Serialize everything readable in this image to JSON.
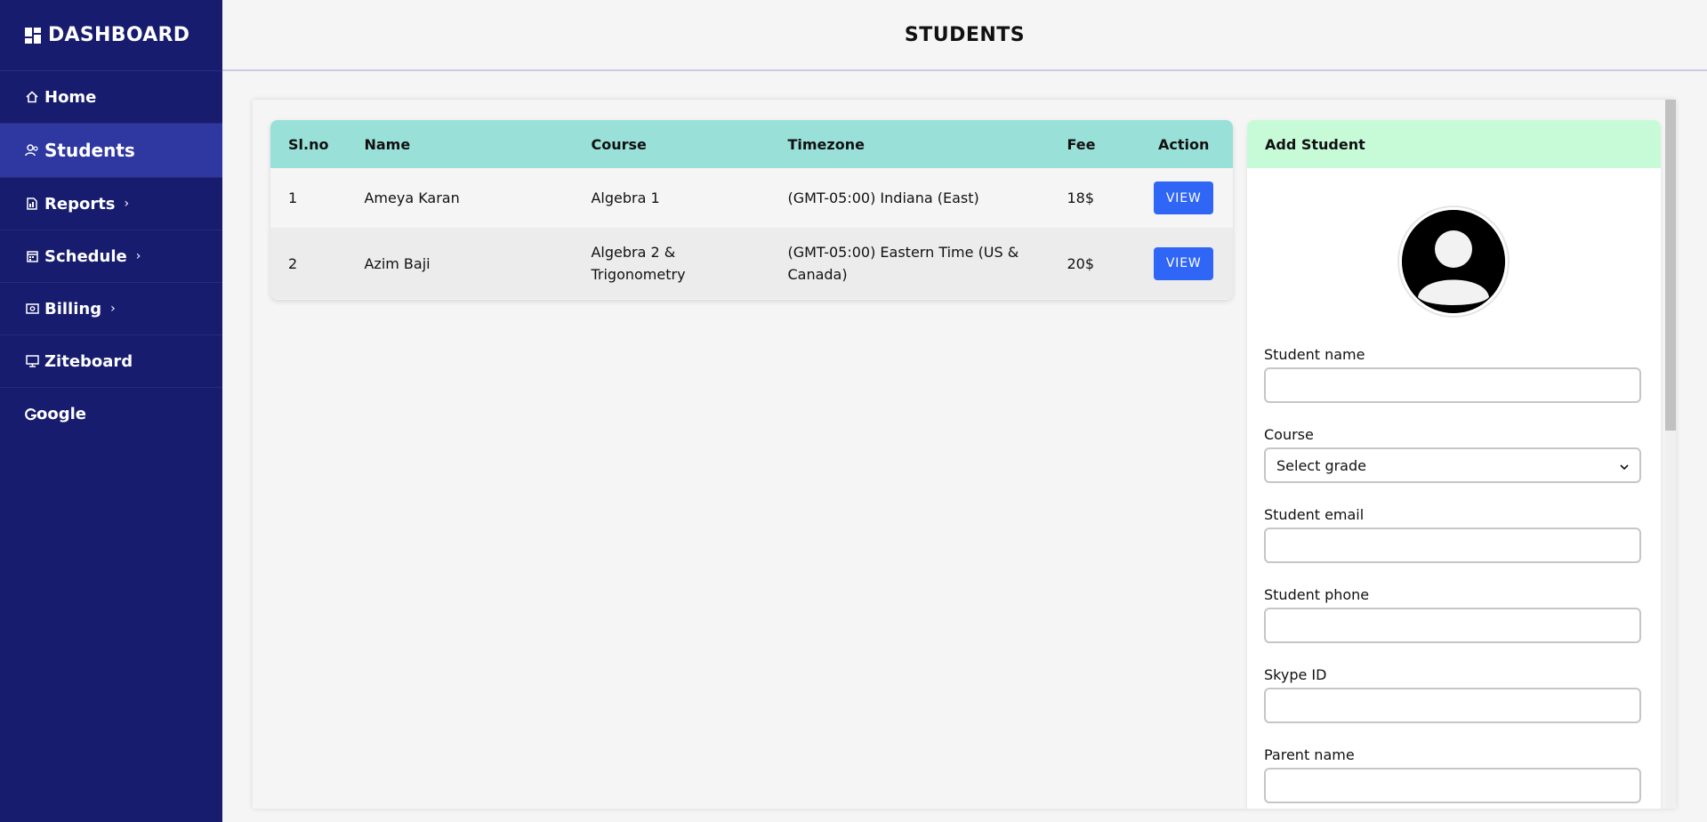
{
  "sidebar": {
    "brand": "DASHBOARD",
    "items": [
      {
        "label": "Home",
        "icon": "home-icon",
        "chevron": ""
      },
      {
        "label": "Students",
        "icon": "students-icon",
        "chevron": ""
      },
      {
        "label": "Reports",
        "icon": "report-icon",
        "chevron": "›"
      },
      {
        "label": "Schedule",
        "icon": "calendar-icon",
        "chevron": "›"
      },
      {
        "label": "Billing",
        "icon": "billing-icon",
        "chevron": "›"
      },
      {
        "label": "Ziteboard",
        "icon": "whiteboard-icon",
        "chevron": ""
      },
      {
        "label": "oogle",
        "icon": "google-icon",
        "chevron": ""
      }
    ],
    "active_item": "Students",
    "colors": {
      "background": "#171c6e",
      "active": "#2f37a0"
    }
  },
  "header": {
    "title": "STUDENTS"
  },
  "table": {
    "columns": [
      "Sl.no",
      "Name",
      "Course",
      "Timezone",
      "Fee",
      "Action"
    ],
    "rows": [
      {
        "sl": "1",
        "name": "Ameya Karan",
        "course": "Algebra 1",
        "timezone": "(GMT-05:00) Indiana (East)",
        "fee": "18$",
        "action": "VIEW"
      },
      {
        "sl": "2",
        "name": "Azim Baji",
        "course": "Algebra 2 & Trigonometry",
        "timezone": "(GMT-05:00) Eastern Time (US & Canada)",
        "fee": "20$",
        "action": "VIEW"
      }
    ],
    "header_color": "#99e0d9",
    "button_color": "#2f66f5"
  },
  "add_student": {
    "title": "Add Student",
    "header_color": "#c7fbd8",
    "fields": {
      "student_name": {
        "label": "Student name",
        "value": ""
      },
      "course": {
        "label": "Course",
        "value": "Select grade"
      },
      "student_email": {
        "label": "Student email",
        "value": ""
      },
      "student_phone": {
        "label": "Student phone",
        "value": ""
      },
      "skype_id": {
        "label": "Skype ID",
        "value": ""
      },
      "parent_name": {
        "label": "Parent name",
        "value": ""
      }
    }
  }
}
